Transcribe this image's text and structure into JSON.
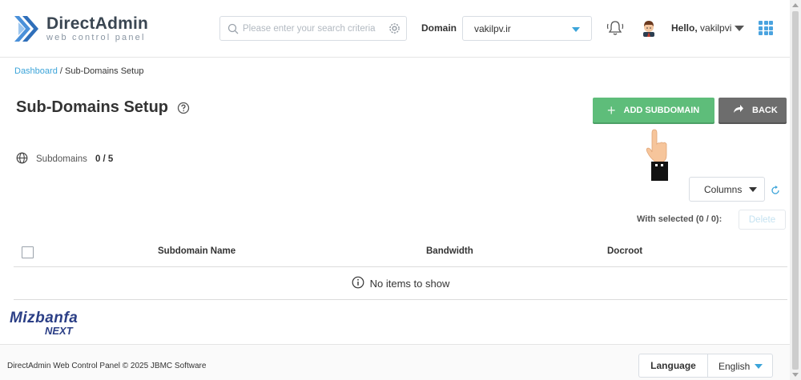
{
  "header": {
    "logo_title": "DirectAdmin",
    "logo_subtitle": "web control panel",
    "search_placeholder": "Please enter your search criteria",
    "domain_label": "Domain",
    "domain_value": "vakilpv.ir",
    "hello_prefix": "Hello,",
    "username": "vakilpvi"
  },
  "breadcrumb": {
    "link": "Dashboard",
    "separator": " / ",
    "current": "Sub-Domains Setup"
  },
  "page": {
    "title": "Sub-Domains Setup",
    "add_button": "ADD SUBDOMAIN",
    "back_button": "BACK",
    "subdomains_label": "Subdomains",
    "subdomains_count": "0 / 5",
    "columns_button": "Columns",
    "with_selected": "With selected (0 / 0):",
    "delete_button": "Delete"
  },
  "table": {
    "columns": [
      "Subdomain Name",
      "Bandwidth",
      "Docroot"
    ],
    "empty_message": "No items to show"
  },
  "brand": {
    "line1": "Mizbanfa",
    "line2": "NEXT"
  },
  "footer": {
    "copyright": "DirectAdmin Web Control Panel © 2025 JBMC Software",
    "language_label": "Language",
    "language_value": "English"
  },
  "colors": {
    "accent_blue": "#3ba4d9",
    "add_green": "#5ebd7a",
    "back_gray": "#6d6d6d",
    "brand_navy": "#2b3f86"
  }
}
